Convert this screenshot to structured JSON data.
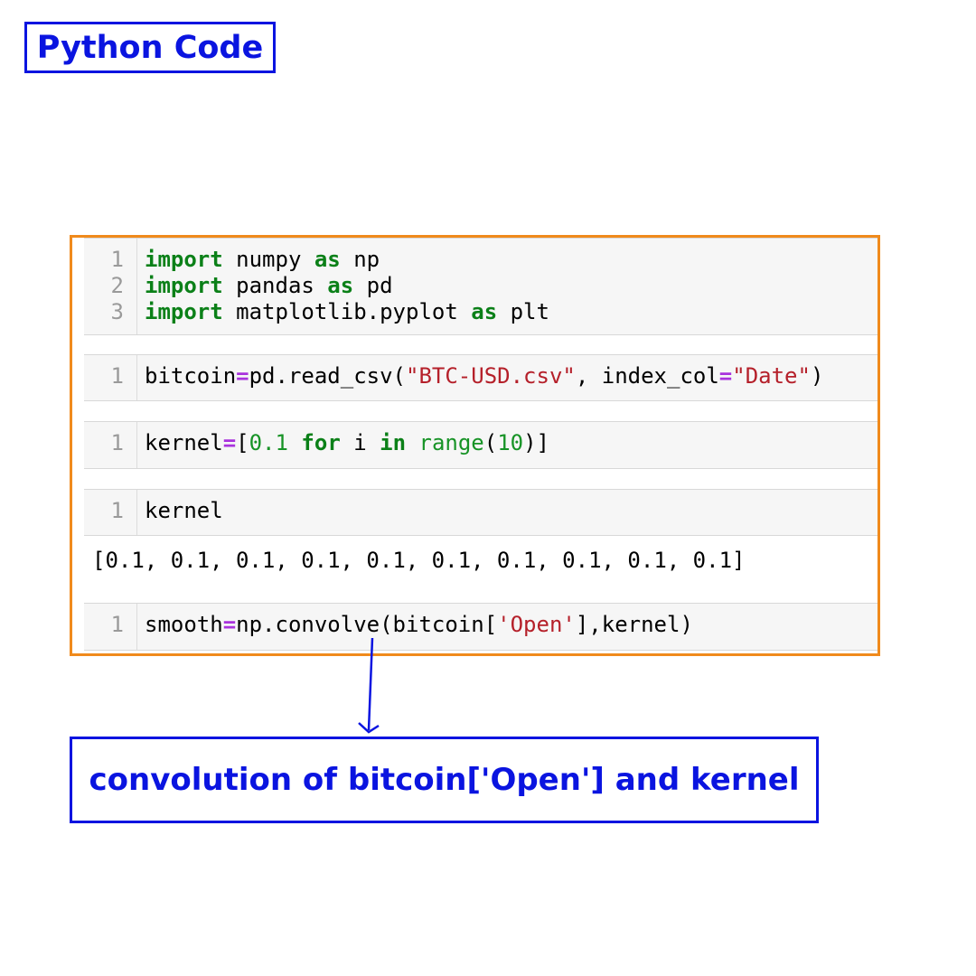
{
  "title": "Python Code",
  "cells": [
    {
      "lines": [
        {
          "num": "1",
          "tokens": [
            {
              "t": "import",
              "c": "kw"
            },
            {
              "t": " numpy ",
              "c": ""
            },
            {
              "t": "as",
              "c": "kw"
            },
            {
              "t": " np",
              "c": ""
            }
          ]
        },
        {
          "num": "2",
          "tokens": [
            {
              "t": "import",
              "c": "kw"
            },
            {
              "t": " pandas ",
              "c": ""
            },
            {
              "t": "as",
              "c": "kw"
            },
            {
              "t": " pd",
              "c": ""
            }
          ]
        },
        {
          "num": "3",
          "tokens": [
            {
              "t": "import",
              "c": "kw"
            },
            {
              "t": " matplotlib.pyplot ",
              "c": ""
            },
            {
              "t": "as",
              "c": "kw"
            },
            {
              "t": " plt",
              "c": ""
            }
          ]
        }
      ]
    },
    {
      "lines": [
        {
          "num": "1",
          "tokens": [
            {
              "t": "bitcoin",
              "c": ""
            },
            {
              "t": "=",
              "c": "op"
            },
            {
              "t": "pd.read_csv(",
              "c": ""
            },
            {
              "t": "\"BTC-USD.csv\"",
              "c": "str"
            },
            {
              "t": ", index_col",
              "c": ""
            },
            {
              "t": "=",
              "c": "op"
            },
            {
              "t": "\"Date\"",
              "c": "str"
            },
            {
              "t": ")",
              "c": ""
            }
          ]
        }
      ]
    },
    {
      "lines": [
        {
          "num": "1",
          "tokens": [
            {
              "t": "kernel",
              "c": ""
            },
            {
              "t": "=",
              "c": "op"
            },
            {
              "t": "[",
              "c": ""
            },
            {
              "t": "0.1",
              "c": "num"
            },
            {
              "t": " ",
              "c": ""
            },
            {
              "t": "for",
              "c": "kw"
            },
            {
              "t": " i ",
              "c": ""
            },
            {
              "t": "in",
              "c": "kw"
            },
            {
              "t": " ",
              "c": ""
            },
            {
              "t": "range",
              "c": "bi"
            },
            {
              "t": "(",
              "c": ""
            },
            {
              "t": "10",
              "c": "num"
            },
            {
              "t": ")]",
              "c": ""
            }
          ]
        }
      ]
    },
    {
      "lines": [
        {
          "num": "1",
          "tokens": [
            {
              "t": "kernel",
              "c": ""
            }
          ]
        }
      ]
    },
    {
      "lines": [
        {
          "num": "1",
          "tokens": [
            {
              "t": "smooth",
              "c": ""
            },
            {
              "t": "=",
              "c": "op"
            },
            {
              "t": "np.convolve(bitcoin[",
              "c": ""
            },
            {
              "t": "'Open'",
              "c": "str"
            },
            {
              "t": "],kernel)",
              "c": ""
            }
          ]
        }
      ]
    }
  ],
  "output": "[0.1, 0.1, 0.1, 0.1, 0.1, 0.1, 0.1, 0.1, 0.1, 0.1]",
  "caption": "convolution of bitcoin['Open'] and kernel",
  "colors": {
    "accent_blue": "#0a14e0",
    "frame_orange": "#f08a1c",
    "keyword_green": "#0b8018",
    "operator_purple": "#a933dd",
    "string_red": "#b5202a"
  }
}
